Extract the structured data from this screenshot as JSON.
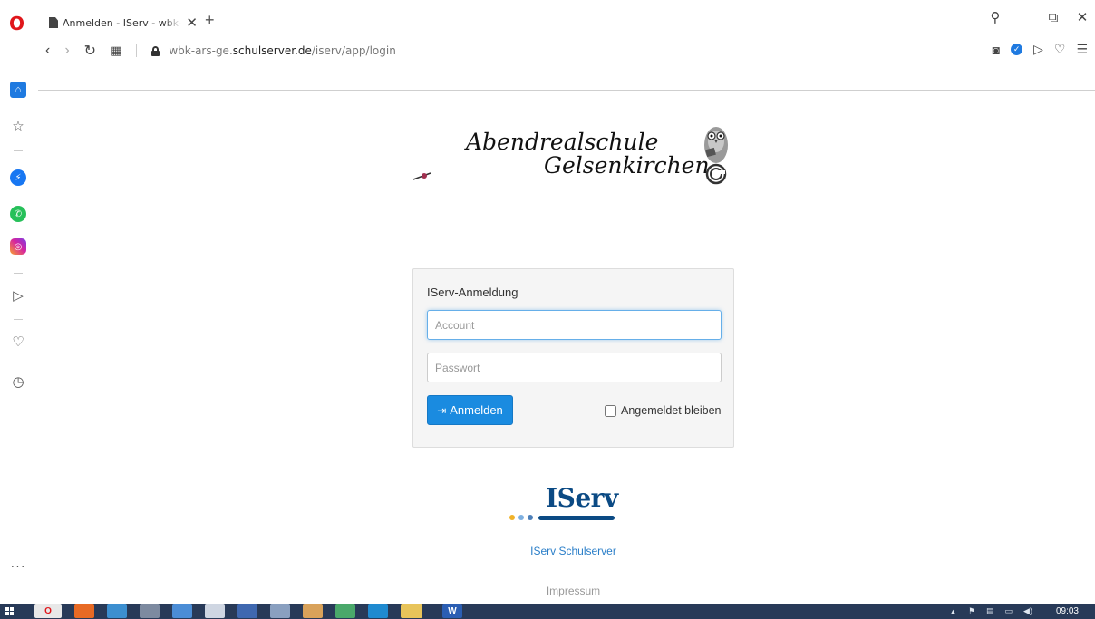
{
  "browser": {
    "tab_title": "Anmelden - IServ - wbk-ars-ge.schulserver.de",
    "url_prefix": "wbk-ars-ge.",
    "url_domain": "schulserver.de",
    "url_path": "/iserv/app/login",
    "opera_logo": "O"
  },
  "school_logo": {
    "line1": "Abendrealschule",
    "line2": "Gelsenkirchen"
  },
  "login": {
    "heading": "IServ-Anmeldung",
    "account_placeholder": "Account",
    "password_placeholder": "Passwort",
    "button_label": "Anmelden",
    "remember_label": "Angemeldet bleiben"
  },
  "footer": {
    "iserv_brand": "IServ",
    "schulserver_link": "IServ Schulserver",
    "impressum_link": "Impressum"
  },
  "taskbar": {
    "clock": "09:03"
  },
  "colors": {
    "accent": "#1a8be0",
    "iserv_blue": "#0b4a84",
    "opera_red": "#e0161b"
  }
}
